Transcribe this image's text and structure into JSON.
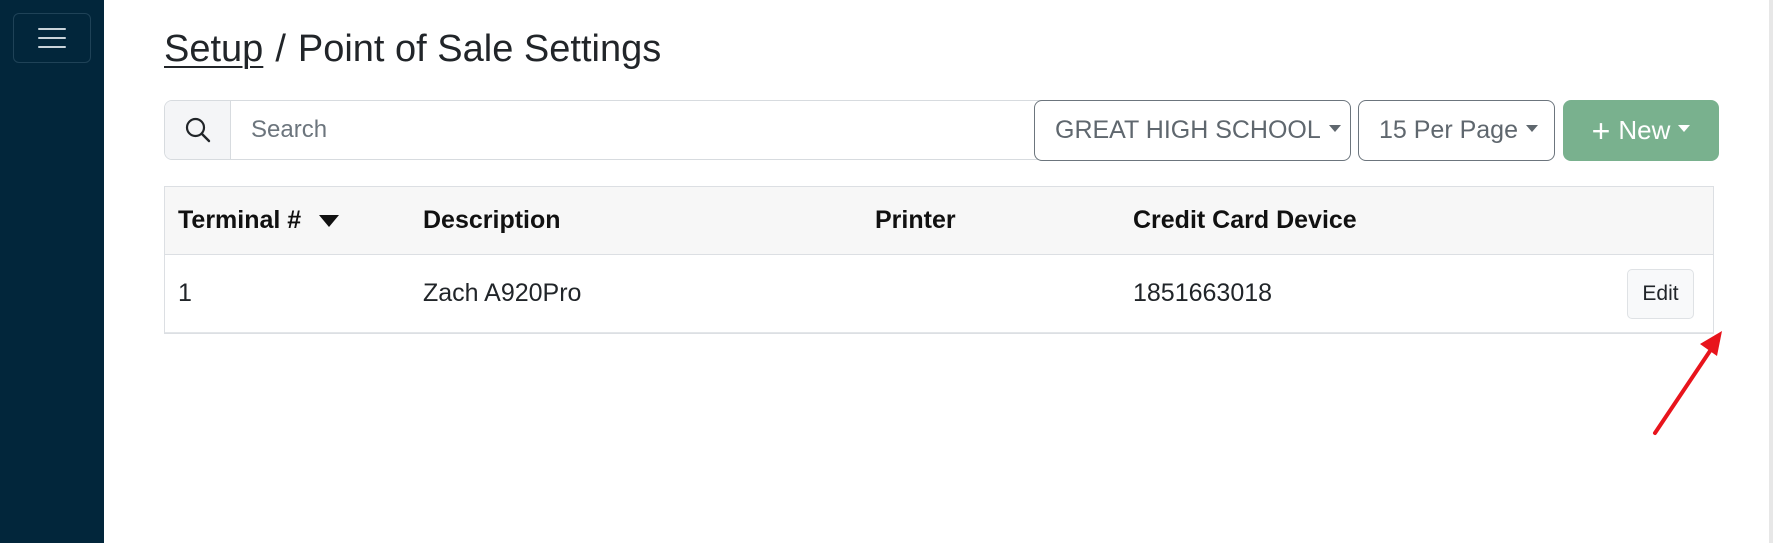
{
  "sidebar": {
    "menu_icon": "hamburger-menu-icon"
  },
  "breadcrumb": {
    "parent": "Setup",
    "separator": "/",
    "current": "Point of Sale Settings"
  },
  "toolbar": {
    "search_icon": "search-icon",
    "search_placeholder": "Search",
    "search_value": "",
    "school_selected": "GREAT HIGH SCHOOL",
    "per_page_selected": "15 Per Page",
    "new_label": "New",
    "new_icon": "plus-icon"
  },
  "table": {
    "columns": [
      "Terminal #",
      "Description",
      "Printer",
      "Credit Card Device",
      ""
    ],
    "sort_indicator": "caret-down-icon",
    "rows": [
      {
        "terminal": "1",
        "description": "Zach A920Pro",
        "printer": "",
        "credit_card_device": "1851663018",
        "action": "Edit"
      }
    ]
  },
  "colors": {
    "sidebar_bg": "#02263b",
    "new_button_bg": "#79b18e",
    "annotation_arrow": "#e8141c"
  }
}
